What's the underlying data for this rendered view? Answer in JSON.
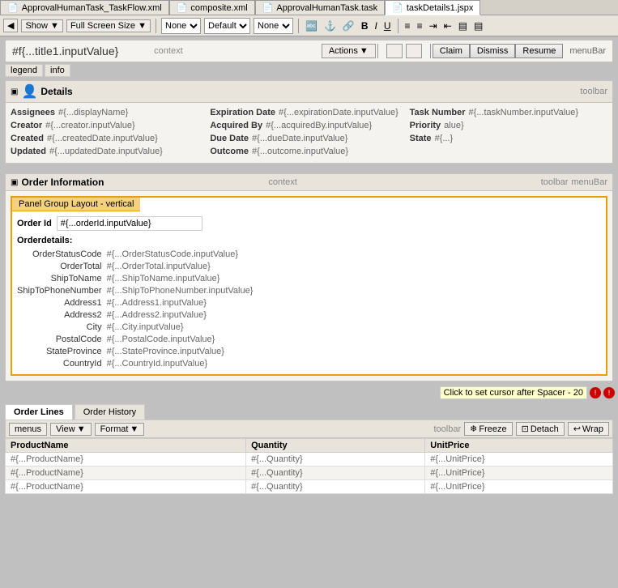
{
  "tabs": [
    {
      "label": "ApprovalHumanTask_TaskFlow.xml",
      "active": false,
      "icon": "📄"
    },
    {
      "label": "composite.xml",
      "active": false,
      "icon": "📄"
    },
    {
      "label": "ApprovalHumanTask.task",
      "active": false,
      "icon": "📄"
    },
    {
      "label": "taskDetails1.jspx",
      "active": true,
      "icon": "📄"
    }
  ],
  "toolbar": {
    "show_label": "Show",
    "screen_size_label": "Full Screen Size",
    "dropdown1": "None",
    "dropdown2": "Default",
    "dropdown3": "None"
  },
  "actions_bar": {
    "page_title": "#f{...title1.inputValue}",
    "context_label": "context",
    "actions_button": "Actions",
    "claim_button": "Claim",
    "dismiss_button": "Dismiss",
    "resume_button": "Resume",
    "menubar_label": "menuBar"
  },
  "legend_tabs": [
    "legend",
    "info"
  ],
  "details": {
    "title": "Details",
    "toolbar_label": "toolbar",
    "fields": {
      "assignees_label": "Assignees",
      "assignees_value": "#{...displayName}",
      "creator_label": "Creator",
      "creator_value": "#{...creator.inputValue}",
      "created_label": "Created",
      "created_value": "#{...createdDate.inputValue}",
      "updated_label": "Updated",
      "updated_value": "#{...updatedDate.inputValue}",
      "expiration_label": "Expiration Date",
      "expiration_value": "#{...expirationDate.inputValue}",
      "acquired_label": "Acquired By",
      "acquired_value": "#{...acquiredBy.inputValue}",
      "due_label": "Due Date",
      "due_value": "#{...dueDate.inputValue}",
      "outcome_label": "Outcome",
      "outcome_value": "#{...outcome.inputValue}",
      "task_number_label": "Task Number",
      "task_number_value": "#{...taskNumber.inputValue}",
      "priority_label": "Priority",
      "priority_value": "alue}",
      "state_label": "State",
      "state_value": "#{...}"
    }
  },
  "order_section": {
    "title": "Order Information",
    "context_label": "context",
    "toolbar_label": "toolbar",
    "menubar_label": "menuBar",
    "panel_group_label": "Panel Group Layout - vertical",
    "order_id_label": "Order Id",
    "order_id_value": "#{...orderId.inputValue}",
    "order_details_label": "Orderdetails:",
    "fields": [
      {
        "label": "OrderStatusCode",
        "value": "#{...OrderStatusCode.inputValue}"
      },
      {
        "label": "OrderTotal",
        "value": "#{...OrderTotal.inputValue}"
      },
      {
        "label": "ShipToName",
        "value": "#{...ShipToName.inputValue}"
      },
      {
        "label": "ShipToPhoneNumber",
        "value": "#{...ShipToPhoneNumber.inputValue}"
      },
      {
        "label": "Address1",
        "value": "#{...Address1.inputValue}"
      },
      {
        "label": "Address2",
        "value": "#{...Address2.inputValue}"
      },
      {
        "label": "City",
        "value": "#{...City.inputValue}"
      },
      {
        "label": "PostalCode",
        "value": "#{...PostalCode.inputValue}"
      },
      {
        "label": "StateProvince",
        "value": "#{...StateProvince.inputValue}"
      },
      {
        "label": "CountryId",
        "value": "#{...CountryId.inputValue}"
      }
    ]
  },
  "spacer": {
    "text": "Click to set cursor after Spacer - 20",
    "icon1": "!",
    "icon2": "!"
  },
  "order_tabs": [
    {
      "label": "Order Lines",
      "active": true
    },
    {
      "label": "Order History",
      "active": false
    }
  ],
  "table_toolbar": {
    "menus_label": "menus",
    "view_label": "View",
    "format_label": "Format",
    "toolbar_label": "toolbar",
    "freeze_label": "Freeze",
    "detach_label": "Detach",
    "wrap_label": "Wrap"
  },
  "table": {
    "columns": [
      "ProductName",
      "Quantity",
      "UnitPrice"
    ],
    "rows": [
      [
        "#{...ProductName}",
        "#{...Quantity}",
        "#{...UnitPrice}"
      ],
      [
        "#{...ProductName}",
        "#{...Quantity}",
        "#{...UnitPrice}"
      ],
      [
        "#{...ProductName}",
        "#{...Quantity}",
        "#{...UnitPrice}"
      ]
    ]
  }
}
